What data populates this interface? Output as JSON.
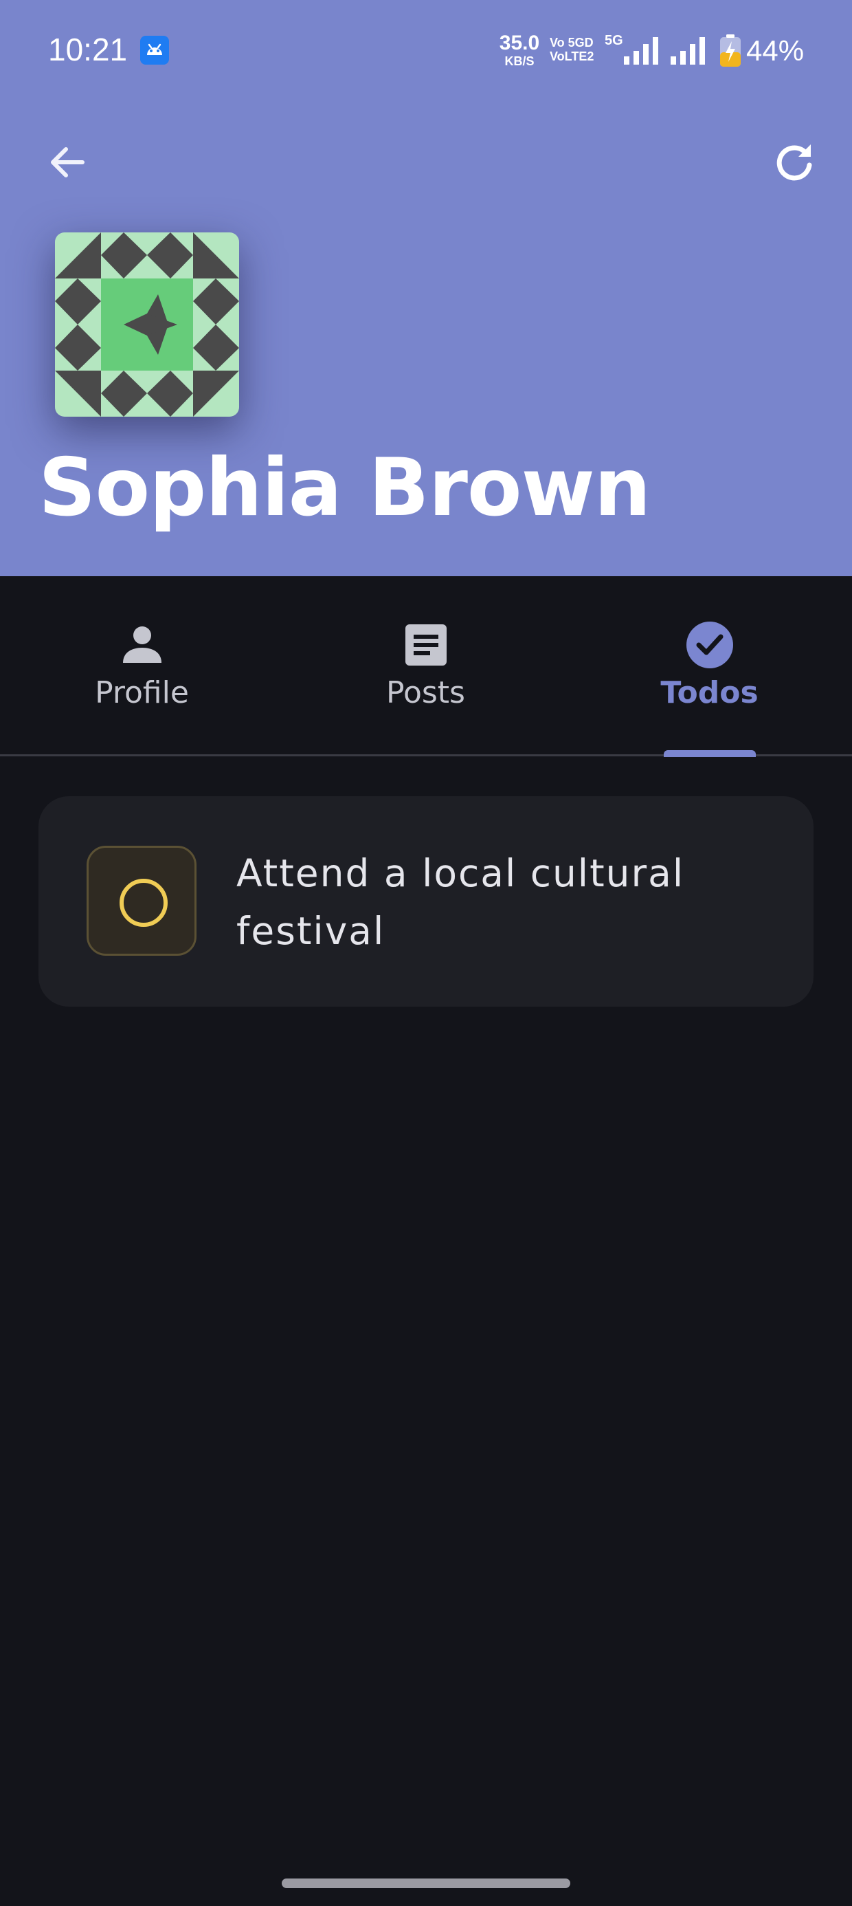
{
  "status_bar": {
    "time": "10:21",
    "net_speed_value": "35.0",
    "net_speed_unit": "KB/S",
    "volte_line1": "Vo 5GD",
    "volte_line2": "VoLTE2",
    "network_type": "5G",
    "battery_percent": "44%",
    "battery_level": 0.44,
    "icons": [
      "android-debug-icon",
      "signal-icon",
      "battery-icon"
    ]
  },
  "header": {
    "background_color": "#7985cc",
    "back_icon": "arrow-left-icon",
    "refresh_icon": "refresh-icon",
    "avatar_icon": "identicon-avatar",
    "name": "Sophia Brown"
  },
  "tabs": [
    {
      "label": "Profile",
      "icon": "person-icon",
      "active": false
    },
    {
      "label": "Posts",
      "icon": "article-icon",
      "active": false
    },
    {
      "label": "Todos",
      "icon": "check-circle-icon",
      "active": true
    }
  ],
  "accent_color": "#7b86d0",
  "todos": [
    {
      "title": "Attend a local cultural festival",
      "completed": false
    }
  ],
  "colors": {
    "background": "#13141a",
    "card": "#1e1f25",
    "pending_ring": "#f0cc55"
  }
}
